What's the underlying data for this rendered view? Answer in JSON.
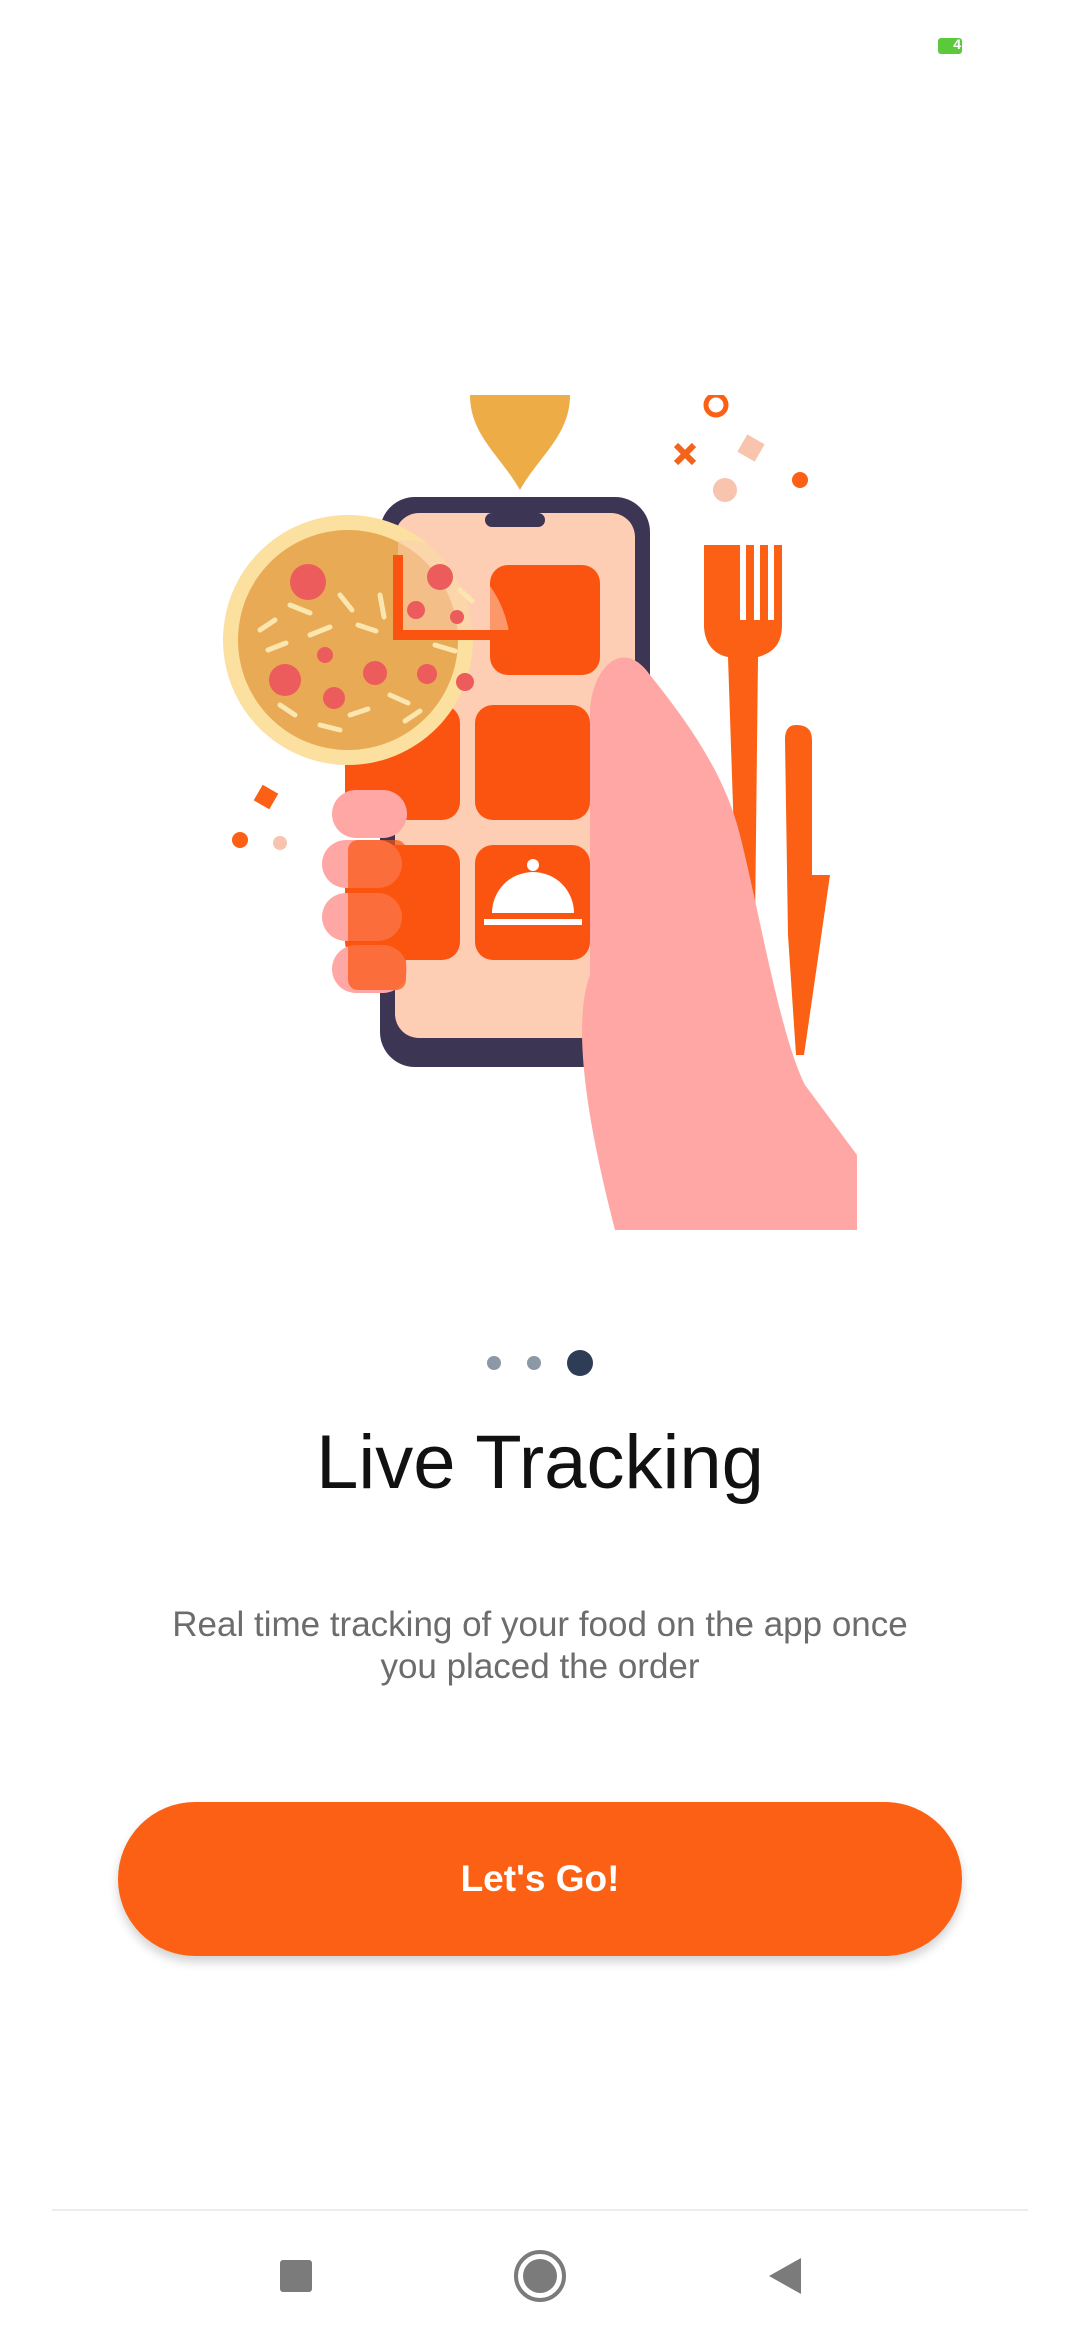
{
  "status_bar": {
    "battery_text": "4",
    "battery_color": "#5cc93a"
  },
  "illustration": {
    "icon": "food-delivery-phone-illustration"
  },
  "pager": {
    "count": 3,
    "active_index": 2
  },
  "onboarding": {
    "title": "Live Tracking",
    "description": "Real time tracking of your food on the app once you placed the order",
    "cta_label": "Let's Go!"
  },
  "colors": {
    "accent": "#fb6014",
    "dot_inactive": "#8d98a7",
    "dot_active": "#2f3c55"
  },
  "nav": {
    "recents_icon": "square-icon",
    "home_icon": "circle-home-icon",
    "back_icon": "triangle-back-icon"
  }
}
